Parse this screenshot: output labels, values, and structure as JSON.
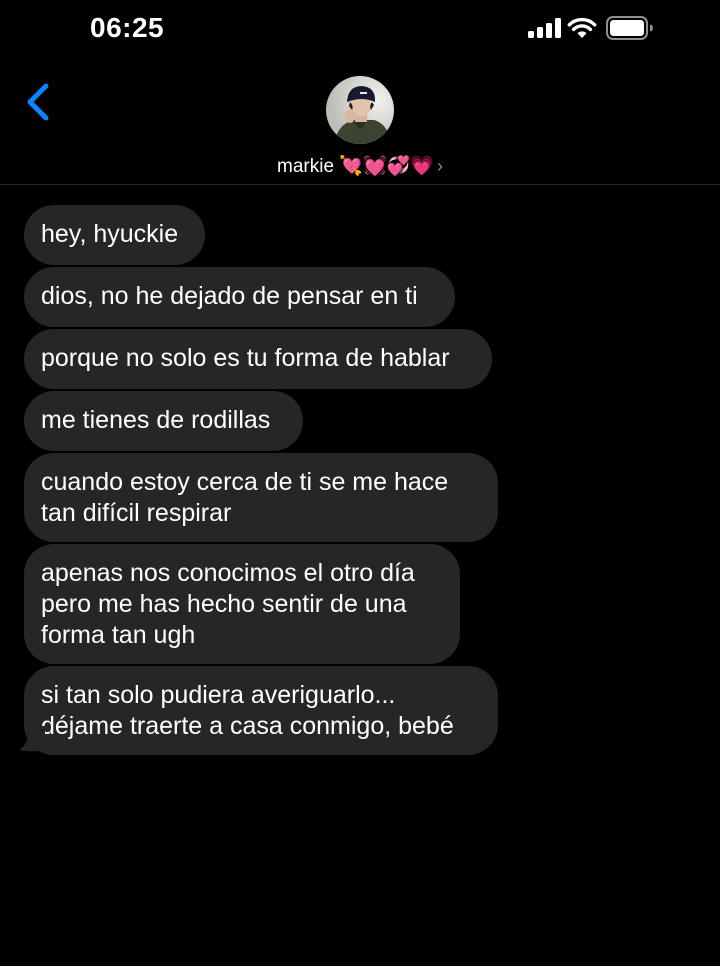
{
  "status_bar": {
    "time": "06:25"
  },
  "header": {
    "contact_name": "markie 💘💓💞💗",
    "chevron": "›",
    "back_icon": "chevron-left-icon"
  },
  "colors": {
    "background": "#000000",
    "bubble": "#262628",
    "accent_blue": "#0a84ff",
    "secondary_text": "#8e8e93"
  },
  "messages": [
    {
      "lines": [
        "hey, hyuckie"
      ]
    },
    {
      "lines": [
        "dios, no he dejado de pensar en ti"
      ]
    },
    {
      "lines": [
        "porque no solo es tu forma de hablar"
      ]
    },
    {
      "lines": [
        "me tienes de rodillas"
      ]
    },
    {
      "lines": [
        "cuando estoy cerca de ti se me hace",
        "tan difícil respirar"
      ]
    },
    {
      "lines": [
        "apenas nos conocimos el otro día",
        "pero me has hecho sentir de una",
        "forma tan ugh"
      ]
    },
    {
      "lines": [
        "si tan solo pudiera averiguarlo...",
        "déjame traerte a casa conmigo, bebé"
      ]
    }
  ]
}
